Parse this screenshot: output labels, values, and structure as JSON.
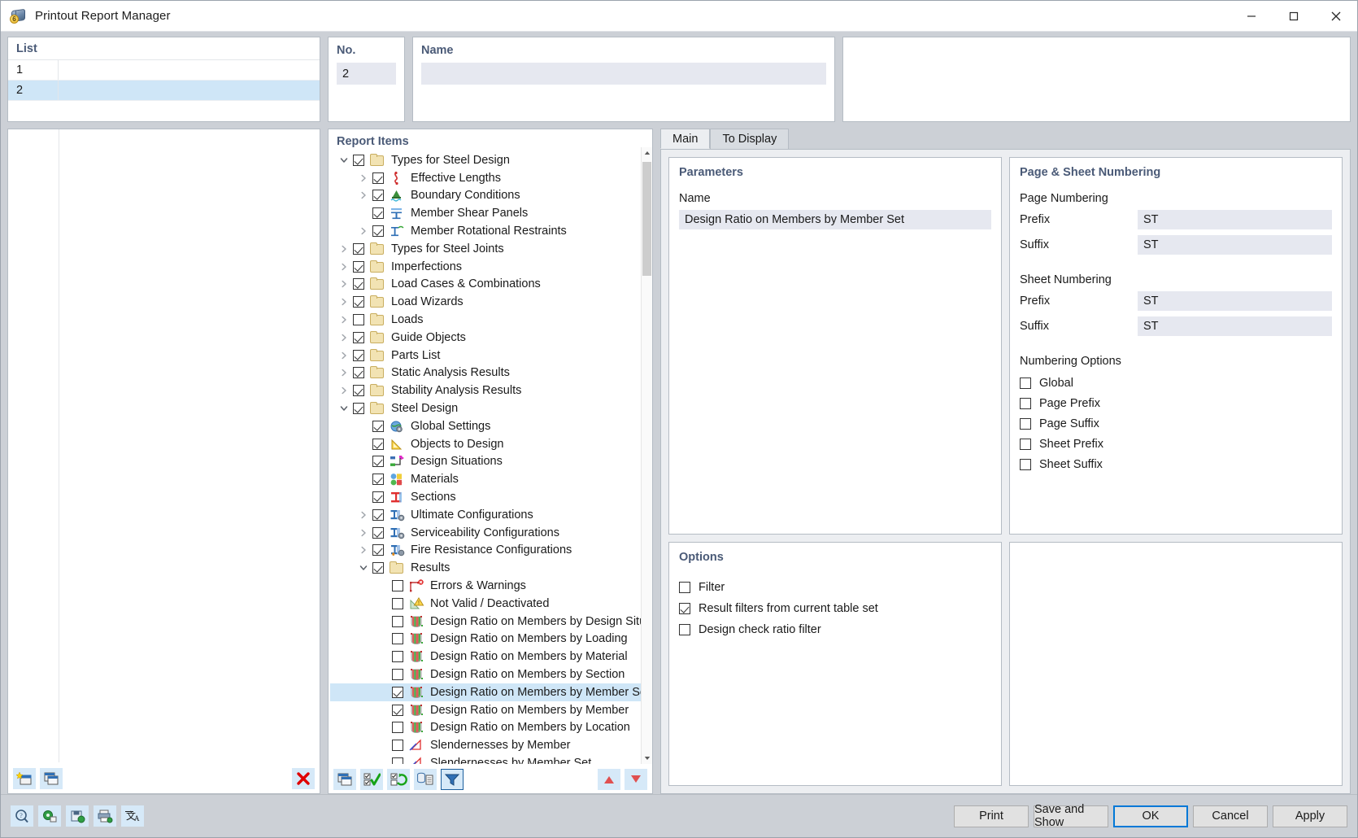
{
  "window": {
    "title": "Printout Report Manager",
    "icon": "report-manager-icon",
    "minimize": "minimize-icon",
    "maximize": "maximize-icon",
    "close": "close-icon"
  },
  "list_panel": {
    "header": "List",
    "rows": [
      {
        "no": "1",
        "name": "",
        "selected": false
      },
      {
        "no": "2",
        "name": "",
        "selected": true
      }
    ],
    "toolbar": [
      {
        "name": "new-report-button",
        "icon": "new-window-star-icon"
      },
      {
        "name": "copy-report-button",
        "icon": "copy-window-icon"
      },
      {
        "name": "delete-report-button",
        "icon": "red-x-icon"
      }
    ]
  },
  "no_field": {
    "label": "No.",
    "value": "2"
  },
  "name_field": {
    "label": "Name",
    "value": ""
  },
  "report_items": {
    "header": "Report Items",
    "nodes": [
      {
        "label": "Types for Steel Design",
        "indent": 0,
        "twist": "down",
        "checked": true,
        "icon": "folder-icon",
        "selected": false
      },
      {
        "label": "Effective Lengths",
        "indent": 1,
        "twist": "right",
        "checked": true,
        "icon": "effective-lengths-icon",
        "selected": false
      },
      {
        "label": "Boundary Conditions",
        "indent": 1,
        "twist": "right",
        "checked": true,
        "icon": "boundary-conditions-icon",
        "selected": false
      },
      {
        "label": "Member Shear Panels",
        "indent": 1,
        "twist": "none",
        "checked": true,
        "icon": "member-shear-panels-icon",
        "selected": false
      },
      {
        "label": "Member Rotational Restraints",
        "indent": 1,
        "twist": "right",
        "checked": true,
        "icon": "member-rotational-restraints-icon",
        "selected": false
      },
      {
        "label": "Types for Steel Joints",
        "indent": 0,
        "twist": "right",
        "checked": true,
        "icon": "folder-icon",
        "selected": false
      },
      {
        "label": "Imperfections",
        "indent": 0,
        "twist": "right",
        "checked": true,
        "icon": "folder-icon",
        "selected": false
      },
      {
        "label": "Load Cases & Combinations",
        "indent": 0,
        "twist": "right",
        "checked": true,
        "icon": "folder-icon",
        "selected": false
      },
      {
        "label": "Load Wizards",
        "indent": 0,
        "twist": "right",
        "checked": true,
        "icon": "folder-icon",
        "selected": false
      },
      {
        "label": "Loads",
        "indent": 0,
        "twist": "right",
        "checked": false,
        "icon": "folder-icon",
        "selected": false
      },
      {
        "label": "Guide Objects",
        "indent": 0,
        "twist": "right",
        "checked": true,
        "icon": "folder-icon",
        "selected": false
      },
      {
        "label": "Parts List",
        "indent": 0,
        "twist": "right",
        "checked": true,
        "icon": "folder-icon",
        "selected": false
      },
      {
        "label": "Static Analysis Results",
        "indent": 0,
        "twist": "right",
        "checked": true,
        "icon": "folder-icon",
        "selected": false
      },
      {
        "label": "Stability Analysis Results",
        "indent": 0,
        "twist": "right",
        "checked": true,
        "icon": "folder-icon",
        "selected": false
      },
      {
        "label": "Steel Design",
        "indent": 0,
        "twist": "down",
        "checked": true,
        "icon": "folder-icon",
        "selected": false
      },
      {
        "label": "Global Settings",
        "indent": 1,
        "twist": "none",
        "checked": true,
        "icon": "global-settings-icon",
        "selected": false
      },
      {
        "label": "Objects to Design",
        "indent": 1,
        "twist": "none",
        "checked": true,
        "icon": "objects-to-design-icon",
        "selected": false
      },
      {
        "label": "Design Situations",
        "indent": 1,
        "twist": "none",
        "checked": true,
        "icon": "design-situations-icon",
        "selected": false
      },
      {
        "label": "Materials",
        "indent": 1,
        "twist": "none",
        "checked": true,
        "icon": "materials-icon",
        "selected": false
      },
      {
        "label": "Sections",
        "indent": 1,
        "twist": "none",
        "checked": true,
        "icon": "sections-icon",
        "selected": false
      },
      {
        "label": "Ultimate Configurations",
        "indent": 1,
        "twist": "right",
        "checked": true,
        "icon": "ultimate-configurations-icon",
        "selected": false
      },
      {
        "label": "Serviceability Configurations",
        "indent": 1,
        "twist": "right",
        "checked": true,
        "icon": "serviceability-configurations-icon",
        "selected": false
      },
      {
        "label": "Fire Resistance Configurations",
        "indent": 1,
        "twist": "right",
        "checked": true,
        "icon": "fire-resistance-configurations-icon",
        "selected": false
      },
      {
        "label": "Results",
        "indent": 1,
        "twist": "down",
        "checked": true,
        "icon": "folder-icon",
        "selected": false
      },
      {
        "label": "Errors & Warnings",
        "indent": 2,
        "twist": "none",
        "checked": false,
        "icon": "errors-warnings-icon",
        "selected": false
      },
      {
        "label": "Not Valid / Deactivated",
        "indent": 2,
        "twist": "none",
        "checked": false,
        "icon": "not-valid-icon",
        "selected": false
      },
      {
        "label": "Design Ratio on Members by Design Situation",
        "indent": 2,
        "twist": "none",
        "checked": false,
        "icon": "design-ratio-icon",
        "selected": false
      },
      {
        "label": "Design Ratio on Members by Loading",
        "indent": 2,
        "twist": "none",
        "checked": false,
        "icon": "design-ratio-icon",
        "selected": false
      },
      {
        "label": "Design Ratio on Members by Material",
        "indent": 2,
        "twist": "none",
        "checked": false,
        "icon": "design-ratio-icon",
        "selected": false
      },
      {
        "label": "Design Ratio on Members by Section",
        "indent": 2,
        "twist": "none",
        "checked": false,
        "icon": "design-ratio-icon",
        "selected": false
      },
      {
        "label": "Design Ratio on Members by Member Set",
        "indent": 2,
        "twist": "none",
        "checked": true,
        "icon": "design-ratio-icon",
        "selected": true
      },
      {
        "label": "Design Ratio on Members by Member",
        "indent": 2,
        "twist": "none",
        "checked": true,
        "icon": "design-ratio-icon",
        "selected": false
      },
      {
        "label": "Design Ratio on Members by Location",
        "indent": 2,
        "twist": "none",
        "checked": false,
        "icon": "design-ratio-icon",
        "selected": false
      },
      {
        "label": "Slendernesses by Member",
        "indent": 2,
        "twist": "none",
        "checked": false,
        "icon": "slendernesses-icon",
        "selected": false
      },
      {
        "label": "Slendernesses by Member Set",
        "indent": 2,
        "twist": "none",
        "checked": false,
        "icon": "slendernesses-icon",
        "selected": false
      }
    ],
    "toolbar": [
      {
        "name": "copy-item-button",
        "icon": "copy-window-icon",
        "framed": false
      },
      {
        "name": "select-all-button",
        "icon": "check-all-icon",
        "framed": false
      },
      {
        "name": "invert-selection-button",
        "icon": "invert-selection-icon",
        "framed": false
      },
      {
        "name": "database-export-button",
        "icon": "database-report-icon",
        "framed": false
      },
      {
        "name": "filter-button",
        "icon": "filter-funnel-icon",
        "framed": true
      },
      {
        "name": "move-up-button",
        "icon": "red-up-triangle-icon",
        "framed": false
      },
      {
        "name": "move-down-button",
        "icon": "red-down-triangle-icon",
        "framed": false
      }
    ]
  },
  "tabs": [
    {
      "label": "Main",
      "active": true
    },
    {
      "label": "To Display",
      "active": false
    }
  ],
  "parameters": {
    "title": "Parameters",
    "name_label": "Name",
    "name_value": "Design Ratio on Members by Member Set"
  },
  "numbering": {
    "title": "Page & Sheet Numbering",
    "page_group": "Page Numbering",
    "page_prefix_label": "Prefix",
    "page_prefix_value": "ST",
    "page_suffix_label": "Suffix",
    "page_suffix_value": "ST",
    "sheet_group": "Sheet Numbering",
    "sheet_prefix_label": "Prefix",
    "sheet_prefix_value": "ST",
    "sheet_suffix_label": "Suffix",
    "sheet_suffix_value": "ST",
    "options_group": "Numbering Options",
    "options": [
      {
        "label": "Global",
        "checked": false
      },
      {
        "label": "Page Prefix",
        "checked": false
      },
      {
        "label": "Page Suffix",
        "checked": false
      },
      {
        "label": "Sheet Prefix",
        "checked": false
      },
      {
        "label": "Sheet Suffix",
        "checked": false
      }
    ]
  },
  "options": {
    "title": "Options",
    "items": [
      {
        "label": "Filter",
        "checked": false
      },
      {
        "label": "Result filters from current table set",
        "checked": true
      },
      {
        "label": "Design check ratio filter",
        "checked": false
      }
    ]
  },
  "footer": {
    "icons": [
      {
        "name": "help-button",
        "icon": "help-magnifier-icon"
      },
      {
        "name": "settings-export-button",
        "icon": "green-gear-icon"
      },
      {
        "name": "save-config-button",
        "icon": "save-green-icon"
      },
      {
        "name": "printer-settings-button",
        "icon": "printer-icon"
      },
      {
        "name": "language-button",
        "icon": "translate-icon"
      }
    ],
    "buttons": [
      {
        "label": "Print",
        "name": "print-button",
        "default": false
      },
      {
        "label": "Save and Show",
        "name": "save-and-show-button",
        "default": false
      },
      {
        "label": "OK",
        "name": "ok-button",
        "default": true
      },
      {
        "label": "Cancel",
        "name": "cancel-button",
        "default": false
      },
      {
        "label": "Apply",
        "name": "apply-button",
        "default": false
      }
    ]
  },
  "colors": {
    "selection": "#cfe6f7",
    "accent": "#0078d7",
    "section_title": "#4a5a77",
    "field_bg": "#e6e8f0",
    "danger": "#e00000"
  }
}
